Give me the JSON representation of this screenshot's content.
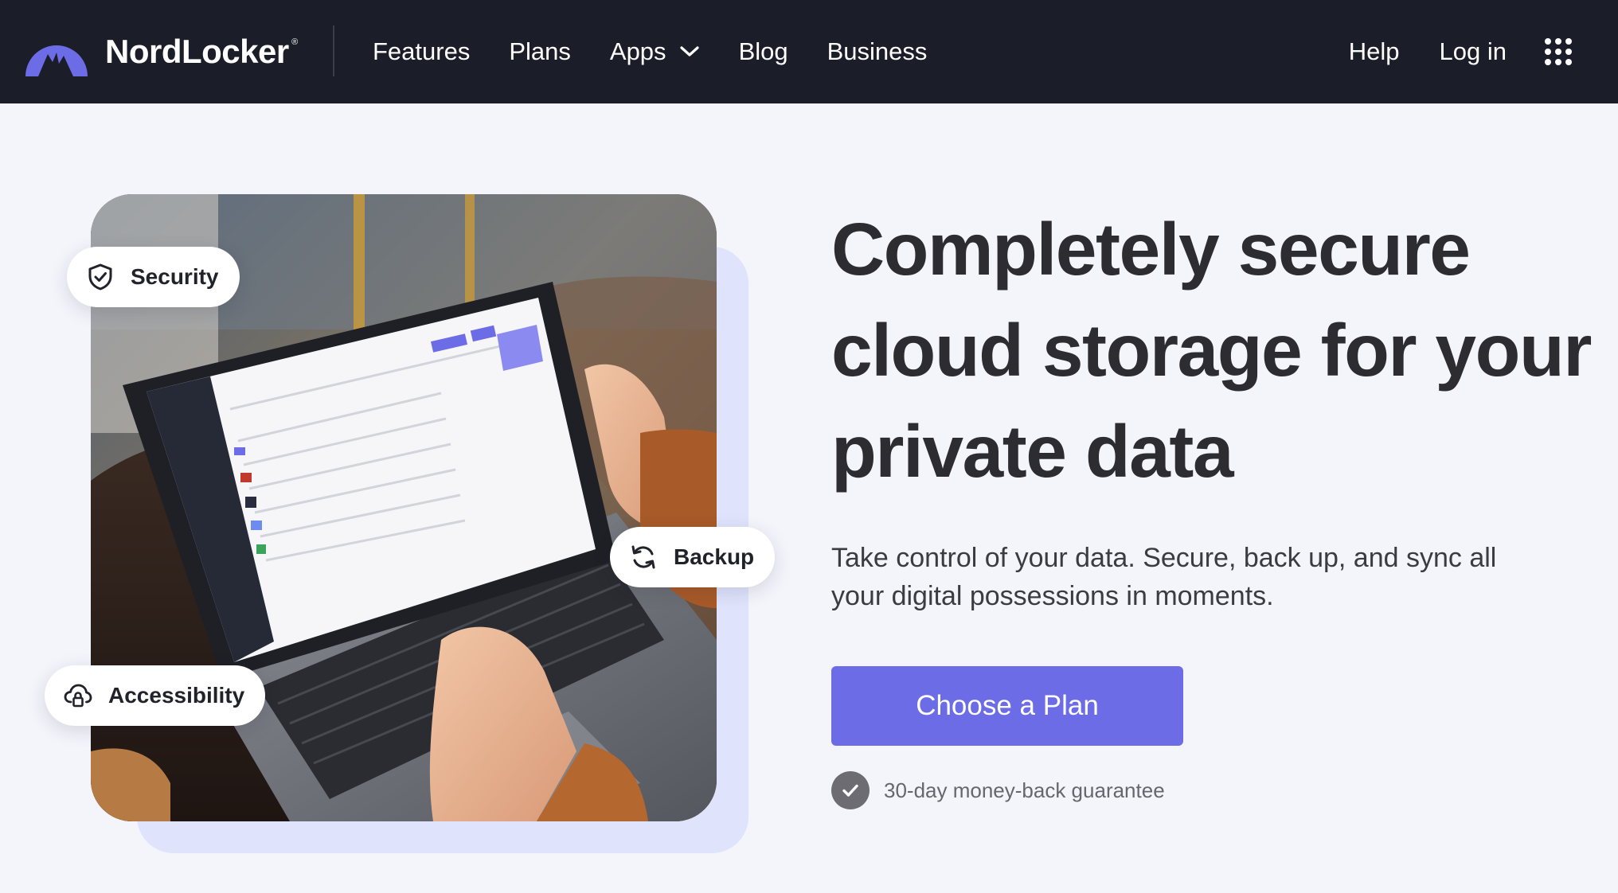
{
  "header": {
    "brand_name": "NordLocker",
    "brand_mark": "®",
    "nav": [
      {
        "label": "Features"
      },
      {
        "label": "Plans"
      },
      {
        "label": "Apps",
        "has_dropdown": true
      },
      {
        "label": "Blog"
      },
      {
        "label": "Business"
      }
    ],
    "right_nav": [
      {
        "label": "Help"
      },
      {
        "label": "Log in"
      }
    ],
    "apps_grid_icon": "grid-dots-icon"
  },
  "hero": {
    "badges": {
      "security": {
        "label": "Security",
        "icon": "shield-check-icon"
      },
      "backup": {
        "label": "Backup",
        "icon": "sync-icon"
      },
      "accessibility": {
        "label": "Accessibility",
        "icon": "cloud-lock-icon"
      }
    },
    "headline": "Completely secure cloud storage for your private data",
    "subtext": "Take control of your data. Secure, back up, and sync all your digital possessions in moments.",
    "cta_label": "Choose a Plan",
    "guarantee_text": "30-day money-back guarantee"
  },
  "colors": {
    "nav_background": "#1b1d29",
    "page_background": "#f4f4fb",
    "accent": "#6c6ce6",
    "logo_purple": "#6c6ce6",
    "image_back_panel": "#dfe3fb"
  }
}
